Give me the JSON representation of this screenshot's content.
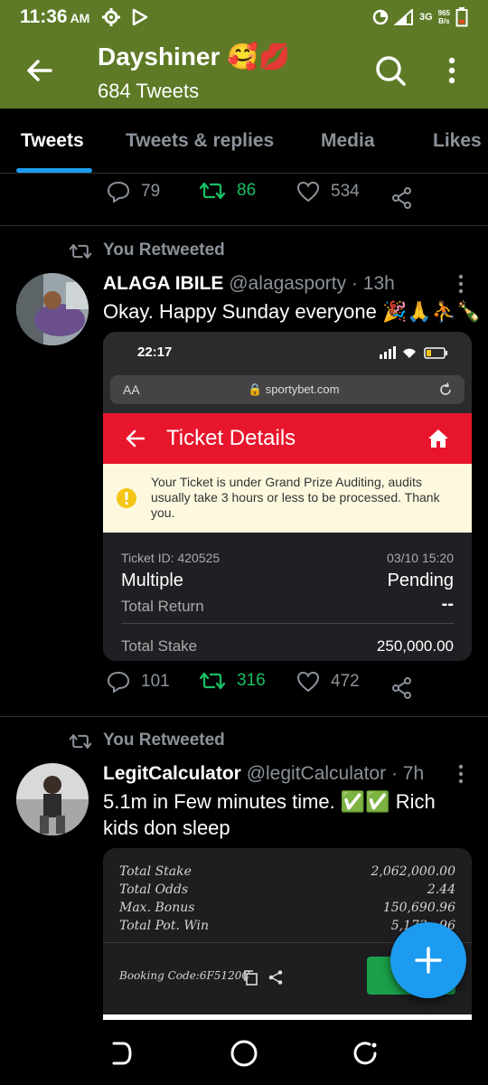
{
  "status_bar": {
    "time": "11:36",
    "ampm": "AM",
    "speed_value": "965",
    "speed_unit": "B/s",
    "network": "3G"
  },
  "header": {
    "title": "Dayshiner 🥰💋",
    "subtitle": "684 Tweets"
  },
  "tabs": [
    {
      "label": "Tweets",
      "active": true
    },
    {
      "label": "Tweets & replies",
      "active": false
    },
    {
      "label": "Media",
      "active": false
    },
    {
      "label": "Likes",
      "active": false
    }
  ],
  "top_actions": {
    "replies": "79",
    "retweets": "86",
    "likes": "534"
  },
  "tweets": [
    {
      "retweet_label": "You Retweeted",
      "name": "ALAGA IBILE",
      "handle": "@alagasporty",
      "time": "· 13h",
      "text": "Okay. Happy Sunday everyone 🎉🙏⛹🍾",
      "media": {
        "status_time": "22:17",
        "url_prefix": "AA",
        "domain": "🔒 sportybet.com",
        "page_title": "Ticket Details",
        "notice": "Your Ticket is under Grand Prize Auditing, audits usually take 3 hours or less to be processed. Thank you.",
        "ticket_id": "Ticket ID: 420525",
        "date": "03/10 15:20",
        "type": "Multiple",
        "status": "Pending",
        "total_return_label": "Total Return",
        "total_return_value": "--",
        "total_stake_label": "Total Stake",
        "total_stake_value": "250,000.00"
      },
      "replies": "101",
      "retweets": "316",
      "likes": "472"
    },
    {
      "retweet_label": "You Retweeted",
      "name": "LegitCalculator",
      "handle": "@legitCalculator",
      "time": "· 7h",
      "text_line1": "5.1m in Few minutes time. ✅✅  Rich",
      "text_line2": "kids don sleep",
      "media": {
        "rows": [
          {
            "label": "Total Stake",
            "value": "2,062,000.00"
          },
          {
            "label": "Total Odds",
            "value": "2.44"
          },
          {
            "label": "Max. Bonus",
            "value": "150,690.96"
          },
          {
            "label": "Total Pot. Win",
            "value": "5,173,..96"
          }
        ],
        "booking_code": "Booking Code:6F5120C"
      }
    }
  ],
  "colors": {
    "header_bg": "#5e7a26",
    "accent": "#1d9bf0",
    "retweet_green": "#17bf63",
    "muted": "#8b9299"
  }
}
